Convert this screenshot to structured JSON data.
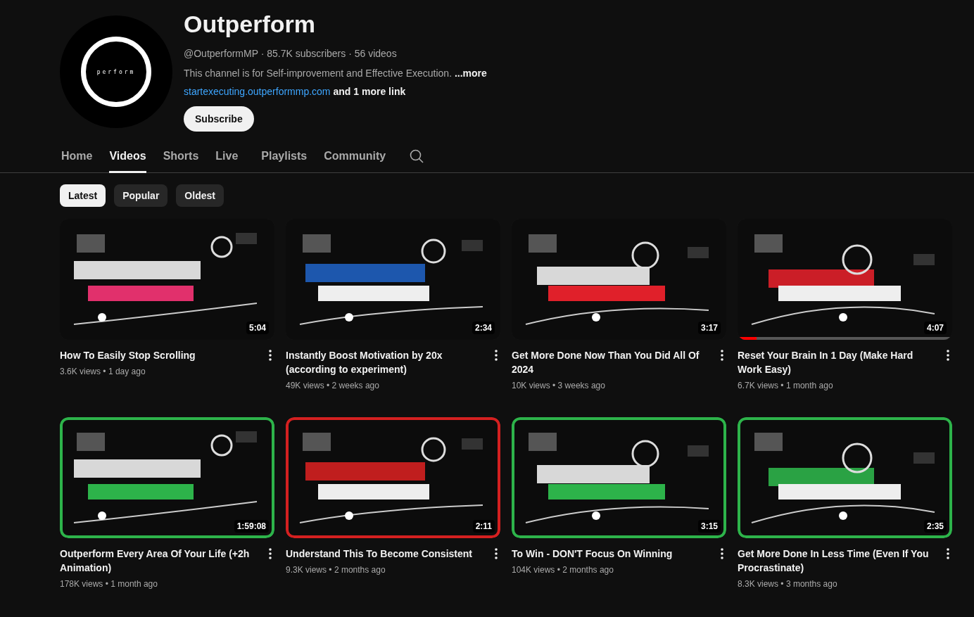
{
  "channel": {
    "avatar_text": "perform",
    "name": "Outperform",
    "stats": "@OutperformMP · 85.7K subscribers · 56 videos",
    "description": "This channel is for Self-improvement and Effective Execution.",
    "more": "...more",
    "link": "startexecuting.outperformmp.com",
    "more_links": "and 1 more link",
    "subscribe": "Subscribe"
  },
  "tabs": [
    {
      "label": "Home",
      "selected": false
    },
    {
      "label": "Videos",
      "selected": true
    },
    {
      "label": "Shorts",
      "selected": false
    },
    {
      "label": "Live",
      "selected": false
    },
    {
      "label": "Playlists",
      "selected": false
    },
    {
      "label": "Community",
      "selected": false
    }
  ],
  "chips": [
    {
      "label": "Latest",
      "selected": true
    },
    {
      "label": "Popular",
      "selected": false
    },
    {
      "label": "Oldest",
      "selected": false
    }
  ],
  "videos": [
    {
      "title": "How To Easily Stop Scrolling",
      "duration": "5:04",
      "meta": "3.6K views • 1 day ago"
    },
    {
      "title": "Instantly Boost Motivation by 20x (according to experiment)",
      "duration": "2:34",
      "meta": "49K views • 2 weeks ago"
    },
    {
      "title": "Get More Done Now Than You Did All Of 2024",
      "duration": "3:17",
      "meta": "10K views • 3 weeks ago"
    },
    {
      "title": "Reset Your Brain In 1 Day (Make Hard Work Easy)",
      "duration": "4:07",
      "meta": "6.7K views • 1 month ago",
      "watched": {
        "level": 0.09
      }
    },
    {
      "title": "Outperform Every Area Of Your Life (+2h Animation)",
      "duration": "1:59:08",
      "meta": "178K views • 1 month ago"
    },
    {
      "title": "Understand This To Become Consistent",
      "duration": "2:11",
      "meta": "9.3K views • 2 months ago"
    },
    {
      "title": "To Win - DON'T Focus On Winning",
      "duration": "3:15",
      "meta": "104K views • 2 months ago"
    },
    {
      "title": "Get More Done In Less Time (Even If You Procrastinate)",
      "duration": "2:35",
      "meta": "8.3K views • 3 months ago"
    }
  ]
}
